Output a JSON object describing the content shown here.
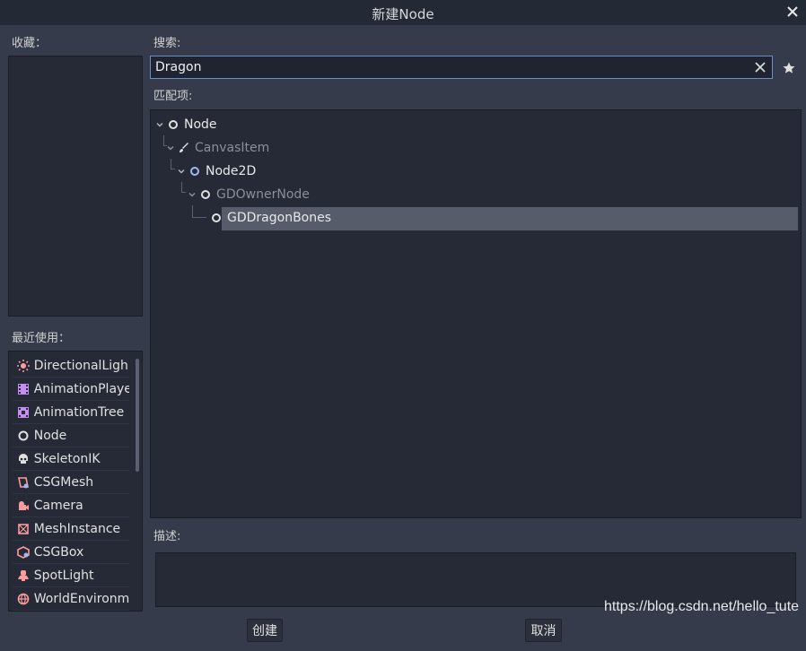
{
  "window": {
    "title": "新建Node"
  },
  "favorites": {
    "label": "收藏："
  },
  "recent": {
    "label": "最近使用：",
    "items": [
      {
        "label": "DirectionalLigh",
        "icon": "directional-light-icon",
        "color": "#fc9c9c"
      },
      {
        "label": "AnimationPlaye",
        "icon": "animation-player-icon",
        "color": "#c38ef1"
      },
      {
        "label": "AnimationTree",
        "icon": "animation-tree-icon",
        "color": "#c38ef1"
      },
      {
        "label": "Node",
        "icon": "node-icon",
        "color": "#e0e0e0"
      },
      {
        "label": "SkeletonIK",
        "icon": "skeleton-ik-icon",
        "color": "#e0e0e0"
      },
      {
        "label": "CSGMesh",
        "icon": "csg-mesh-icon",
        "color": "#fc9c9c"
      },
      {
        "label": "Camera",
        "icon": "camera-icon",
        "color": "#fc9c9c"
      },
      {
        "label": "MeshInstance",
        "icon": "mesh-instance-icon",
        "color": "#fc9c9c"
      },
      {
        "label": "CSGBox",
        "icon": "csg-box-icon",
        "color": "#fc9c9c"
      },
      {
        "label": "SpotLight",
        "icon": "spot-light-icon",
        "color": "#fc9c9c"
      },
      {
        "label": "WorldEnvironm",
        "icon": "world-environment-icon",
        "color": "#fc9c9c"
      }
    ]
  },
  "search": {
    "label": "搜索:",
    "value": "Dragon"
  },
  "matches": {
    "label": "匹配项:",
    "tree": [
      {
        "label": "Node",
        "dim": false
      },
      {
        "label": "CanvasItem",
        "dim": true
      },
      {
        "label": "Node2D",
        "dim": false
      },
      {
        "label": "GDOwnerNode",
        "dim": true
      },
      {
        "label": "GDDragonBones",
        "dim": false,
        "selected": true
      }
    ]
  },
  "description": {
    "label": "描述:",
    "text": ""
  },
  "buttons": {
    "create": "创建",
    "cancel": "取消"
  },
  "watermark": "https://blog.csdn.net/hello_tute"
}
